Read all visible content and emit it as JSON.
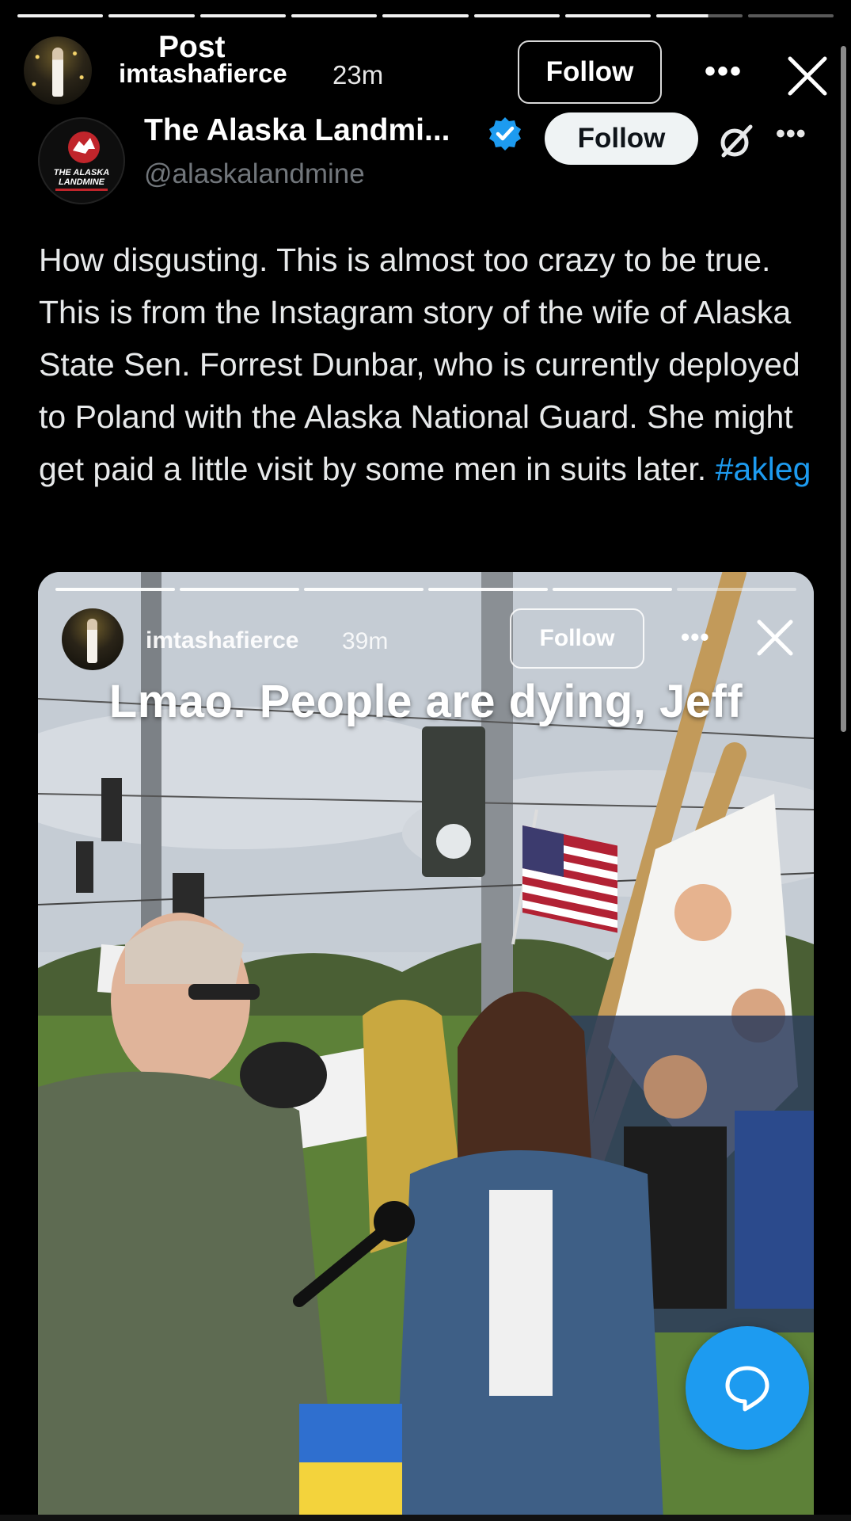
{
  "story": {
    "progress_segments": 9,
    "progress_done": 8,
    "post_label": "Post",
    "username": "imtashafierce",
    "time": "23m",
    "follow_label": "Follow",
    "more_icon": "more-icon",
    "close_icon": "close-icon"
  },
  "tweet": {
    "author_name": "The Alaska Landmi...",
    "handle": "@alaskalandmine",
    "follow_label": "Follow",
    "avatar_text": "THE ALASKA LANDMINE",
    "text_main": "How disgusting. This is almost too crazy to be true. This is from the Instagram story of the wife of Alaska State Sen. Forrest Dunbar, who is currently deployed to Poland with the Alaska National Guard. She might get paid a little visit by some men in suits later. ",
    "hashtag": "#akleg",
    "verified_color": "#1d9bf0",
    "hashtag_color": "#1d9bf0"
  },
  "embedded_story": {
    "username": "imtashafierce",
    "time": "39m",
    "follow_label": "Follow",
    "caption": "Lmao. People are dying, Jeff",
    "progress_segments": 6,
    "progress_done": 5
  },
  "reply_button": {
    "icon": "reply-bubble-icon",
    "color": "#1d9bf0"
  }
}
